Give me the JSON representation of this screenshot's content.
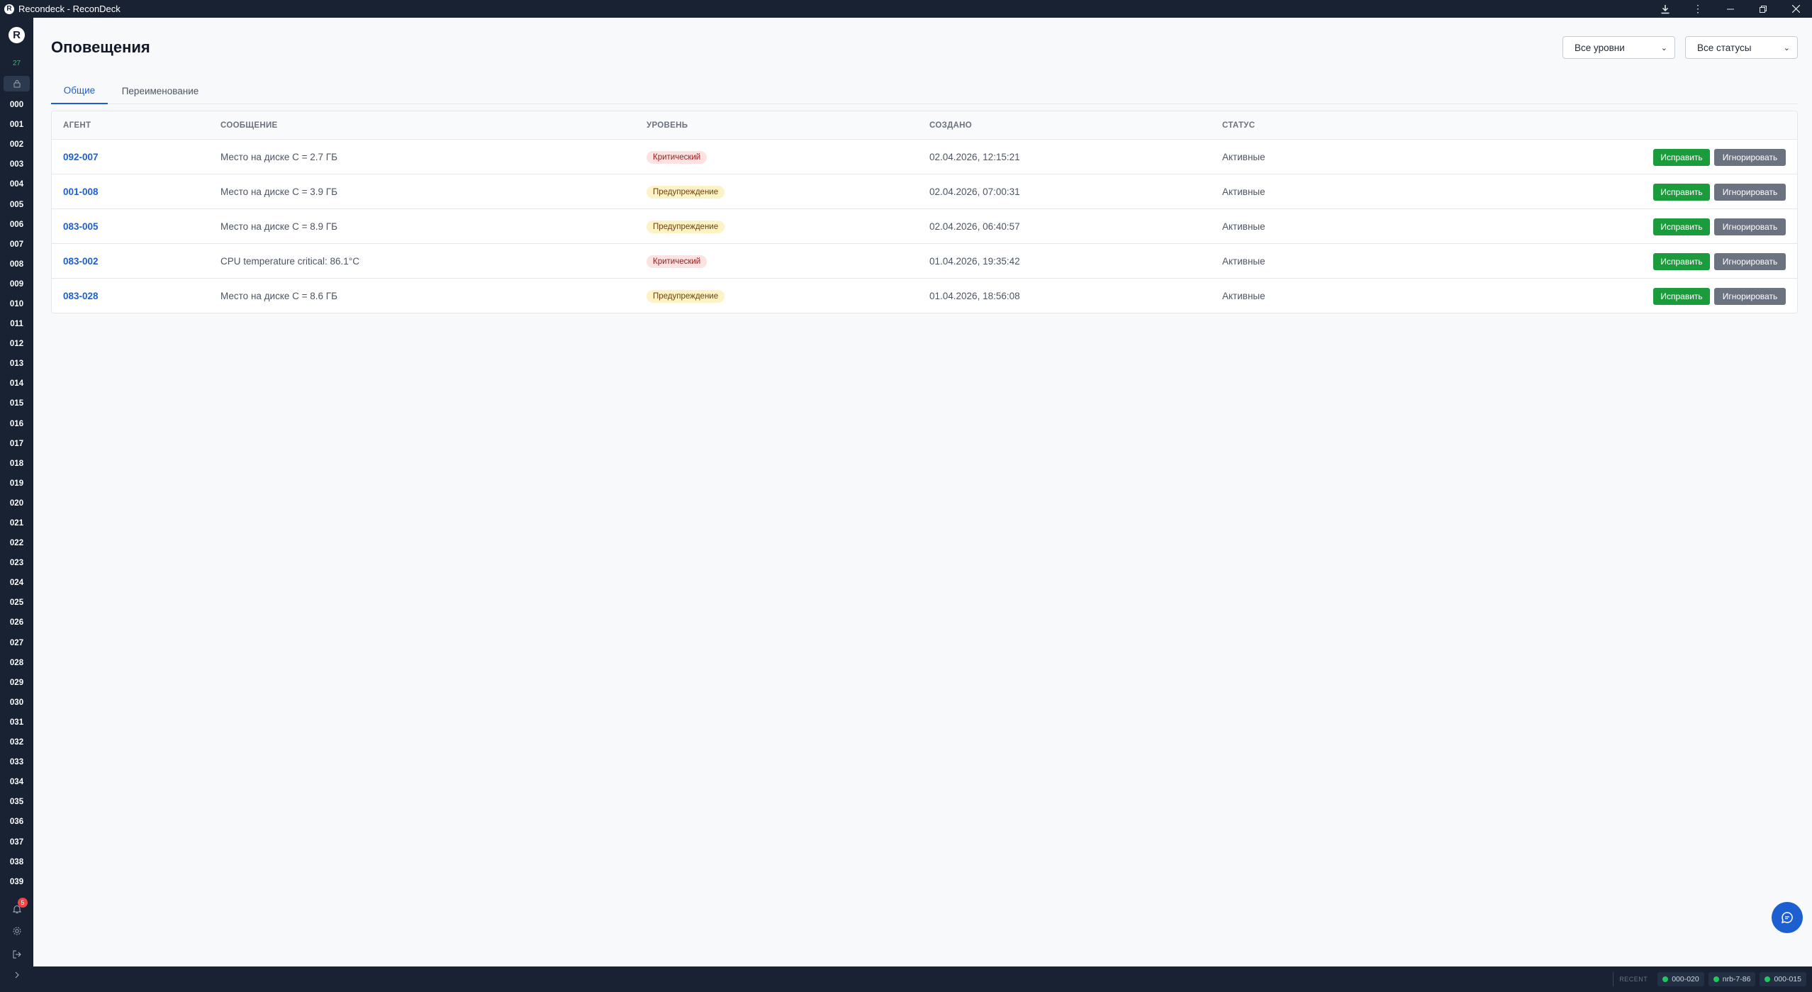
{
  "window": {
    "title": "Recondeck - ReconDeck"
  },
  "sidebar": {
    "logo_letter": "R",
    "online_count": "27",
    "agents": [
      "000",
      "001",
      "002",
      "003",
      "004",
      "005",
      "006",
      "007",
      "008",
      "009",
      "010",
      "011",
      "012",
      "013",
      "014",
      "015",
      "016",
      "017",
      "018",
      "019",
      "020",
      "021",
      "022",
      "023",
      "024",
      "025",
      "026",
      "027",
      "028",
      "029",
      "030",
      "031",
      "032",
      "033",
      "034",
      "035",
      "036",
      "037",
      "038",
      "039"
    ],
    "notifications_count": "5"
  },
  "page": {
    "title": "Оповещения",
    "filters": {
      "level": "Все уровни",
      "status": "Все статусы"
    },
    "tabs": [
      {
        "label": "Общие",
        "active": true
      },
      {
        "label": "Переименование",
        "active": false
      }
    ]
  },
  "table": {
    "columns": [
      "АГЕНТ",
      "СООБЩЕНИЕ",
      "УРОВЕНЬ",
      "СОЗДАНО",
      "СТАТУС"
    ],
    "rows": [
      {
        "agent": "092-007",
        "message": "Место на диске C = 2.7 ГБ",
        "level": "Критический",
        "level_type": "critical",
        "created": "02.04.2026, 12:15:21",
        "status": "Активные"
      },
      {
        "agent": "001-008",
        "message": "Место на диске C = 3.9 ГБ",
        "level": "Предупреждение",
        "level_type": "warning",
        "created": "02.04.2026, 07:00:31",
        "status": "Активные"
      },
      {
        "agent": "083-005",
        "message": "Место на диске C = 8.9 ГБ",
        "level": "Предупреждение",
        "level_type": "warning",
        "created": "02.04.2026, 06:40:57",
        "status": "Активные"
      },
      {
        "agent": "083-002",
        "message": "CPU temperature critical: 86.1°C",
        "level": "Критический",
        "level_type": "critical",
        "created": "01.04.2026, 19:35:42",
        "status": "Активные"
      },
      {
        "agent": "083-028",
        "message": "Место на диске C = 8.6 ГБ",
        "level": "Предупреждение",
        "level_type": "warning",
        "created": "01.04.2026, 18:56:08",
        "status": "Активные"
      }
    ],
    "actions": {
      "fix": "Исправить",
      "ignore": "Игнорировать"
    }
  },
  "statusbar": {
    "recent_label": "RECENT",
    "recent": [
      "000-020",
      "nrb-7-86",
      "000-015"
    ]
  },
  "colors": {
    "sidebar_bg": "#182233",
    "accent": "#1d5fd1",
    "fix_button": "#1a9c3c",
    "ignore_button": "#6b7280",
    "online": "#22c55e"
  }
}
